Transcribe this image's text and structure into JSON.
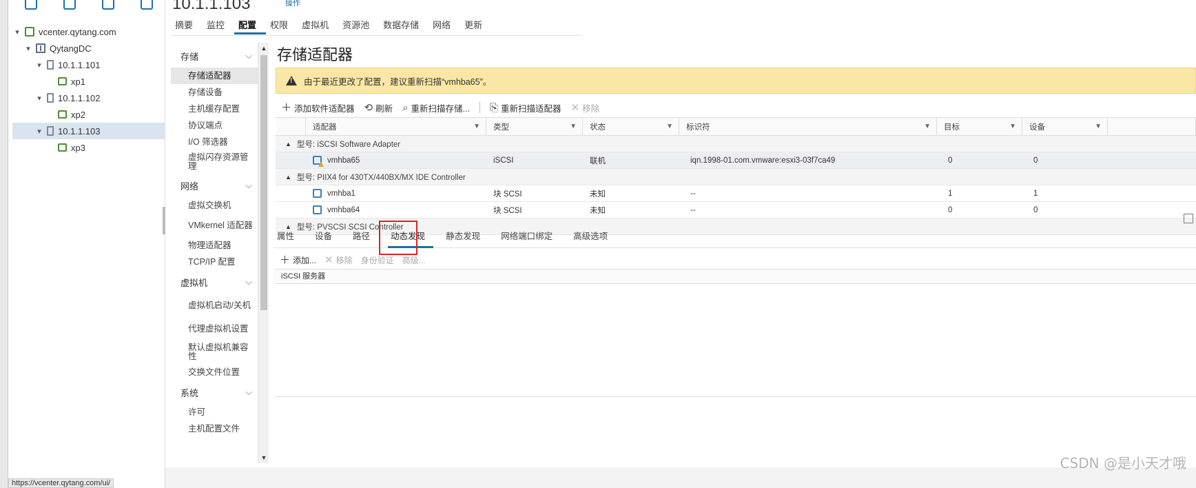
{
  "header": {
    "host_title": "10.1.1.103",
    "actions_label": "操作"
  },
  "tabs": [
    "摘要",
    "监控",
    "配置",
    "权限",
    "虚拟机",
    "资源池",
    "数据存储",
    "网络",
    "更新"
  ],
  "tree": [
    {
      "label": "vcenter.qytang.com",
      "icon": "vcenter-icon"
    },
    {
      "label": "QytangDC",
      "icon": "datacenter-icon"
    },
    {
      "label": "10.1.1.101",
      "icon": "host-icon"
    },
    {
      "label": "xp1",
      "icon": "vm-icon"
    },
    {
      "label": "10.1.1.102",
      "icon": "host-icon"
    },
    {
      "label": "xp2",
      "icon": "vm-icon"
    },
    {
      "label": "10.1.1.103",
      "icon": "host-icon"
    },
    {
      "label": "xp3",
      "icon": "vm-icon"
    }
  ],
  "config_nav": {
    "storage_group": "存储",
    "storage_items": [
      "存储适配器",
      "存储设备",
      "主机缓存配置",
      "协议端点",
      "I/O 筛选器",
      "虚拟闪存资源管理"
    ],
    "network_group": "网络",
    "network_items": [
      "虚拟交换机",
      "VMkernel 适配器",
      "物理适配器",
      "TCP/IP 配置"
    ],
    "vm_group": "虚拟机",
    "vm_items": [
      "虚拟机启动/关机",
      "代理虚拟机设置",
      "默认虚拟机兼容性",
      "交换文件位置"
    ],
    "system_group": "系统",
    "system_items": [
      "许可",
      "主机配置文件"
    ]
  },
  "main": {
    "title": "存储适配器",
    "warning": "由于最近更改了配置，建议重新扫描“vmhba65”。",
    "toolbar": {
      "add": "添加软件适配器",
      "refresh": "刷新",
      "rescan_storage": "重新扫描存储...",
      "rescan_adapter": "重新扫描适配器",
      "remove": "移除"
    },
    "columns": [
      "适配器",
      "类型",
      "状态",
      "标识符",
      "目标",
      "设备"
    ],
    "groups": [
      {
        "label": "型号: iSCSI Software Adapter",
        "rows": [
          {
            "adapter": "vmhba65",
            "type": "iSCSI",
            "status": "联机",
            "identifier": "iqn.1998-01.com.vmware:esxi3-03f7ca49",
            "targets": "0",
            "devices": "0"
          }
        ]
      },
      {
        "label": "型号: PIIX4 for 430TX/440BX/MX IDE Controller",
        "rows": [
          {
            "adapter": "vmhba1",
            "type": "块 SCSI",
            "status": "未知",
            "identifier": "--",
            "targets": "1",
            "devices": "1"
          },
          {
            "adapter": "vmhba64",
            "type": "块 SCSI",
            "status": "未知",
            "identifier": "--",
            "targets": "0",
            "devices": "0"
          }
        ]
      },
      {
        "label": "型号: PVSCSI SCSI Controller",
        "rows": []
      }
    ],
    "lower_tabs": [
      "属性",
      "设备",
      "路径",
      "动态发现",
      "静态发现",
      "网络端口绑定",
      "高级选项"
    ],
    "lower_toolbar": {
      "add": "添加...",
      "remove": "移除",
      "auth": "身份验证",
      "advanced": "高级..."
    },
    "server_column": "iSCSI 服务器"
  },
  "status_url": "https://vcenter.qytang.com/ui/",
  "watermark": "CSDN @是小天才哦",
  "colors": {
    "accent": "#1d6fa5",
    "warning_bg": "#fbe7a5",
    "highlight": "#e02020"
  }
}
